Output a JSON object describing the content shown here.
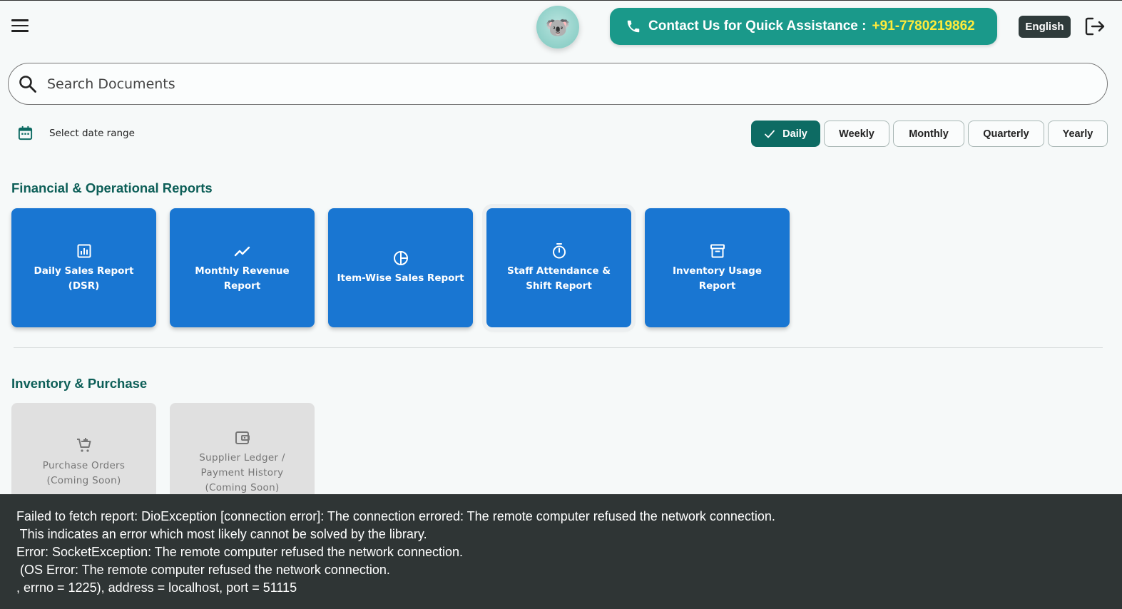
{
  "header": {
    "contact_label": "Contact Us for Quick Assistance :",
    "contact_phone": "+91-7780219862",
    "language": "English",
    "avatar_emoji": "🐨"
  },
  "search": {
    "placeholder": "Search Documents"
  },
  "date_range": {
    "label": "Select date range"
  },
  "periods": {
    "daily": "Daily",
    "weekly": "Weekly",
    "monthly": "Monthly",
    "quarterly": "Quarterly",
    "yearly": "Yearly",
    "selected": "Daily"
  },
  "sections": {
    "financial": {
      "title": "Financial & Operational Reports",
      "cards": [
        {
          "label": "Daily Sales Report (DSR)",
          "icon": "bar-chart-icon"
        },
        {
          "label": "Monthly Revenue Report",
          "icon": "trending-up-icon"
        },
        {
          "label": "Item-Wise Sales Report",
          "icon": "pie-chart-icon"
        },
        {
          "label": "Staff Attendance & Shift Report",
          "icon": "timer-icon"
        },
        {
          "label": "Inventory Usage Report",
          "icon": "archive-icon"
        }
      ]
    },
    "inventory": {
      "title": "Inventory & Purchase",
      "cards": [
        {
          "label": "Purchase Orders (Coming Soon)",
          "icon": "add-cart-icon"
        },
        {
          "label": "Supplier Ledger / Payment History (Coming Soon)",
          "icon": "wallet-icon"
        }
      ]
    }
  },
  "snackbar": {
    "message": "Failed to fetch report: DioException [connection error]: The connection errored: The remote computer refused the network connection.\n This indicates an error which most likely cannot be solved by the library.\nError: SocketException: The remote computer refused the network connection.\n (OS Error: The remote computer refused the network connection.\n, errno = 1225), address = localhost, port = 51115"
  },
  "colors": {
    "primary": "#1976d2",
    "accent": "#1a998a",
    "active_tab": "#0d6b63",
    "phone_highlight": "#ffeb3b",
    "section_title": "#0d5f58"
  }
}
